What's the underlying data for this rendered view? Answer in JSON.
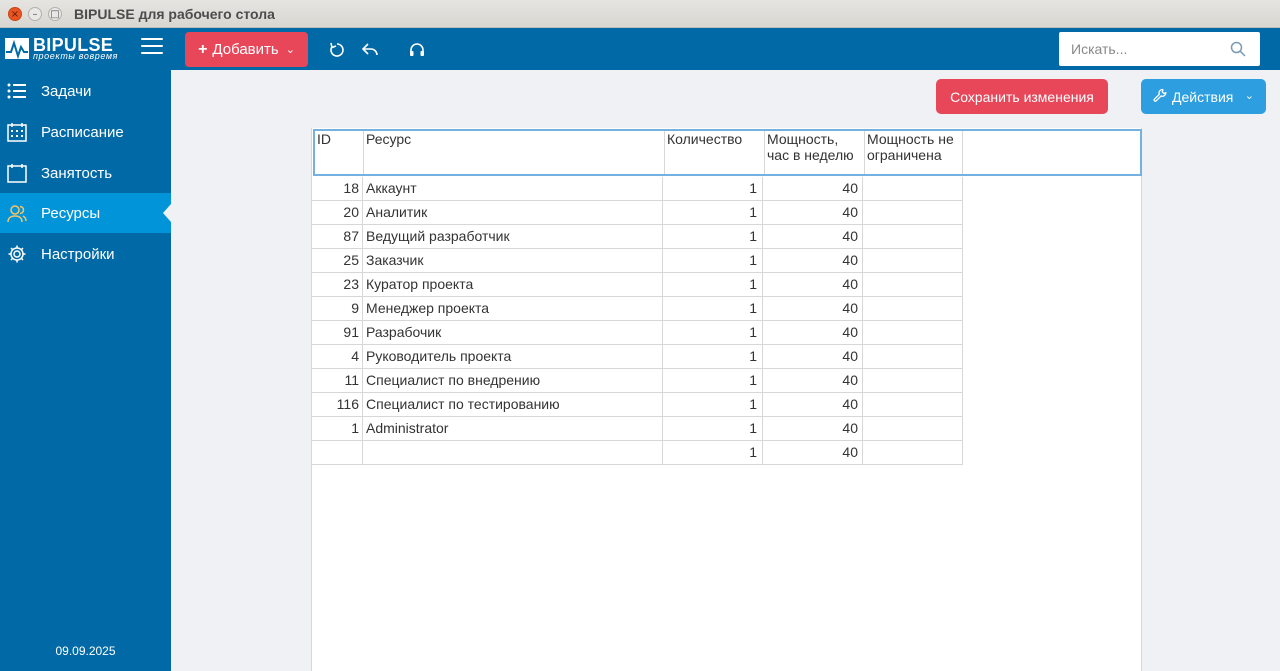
{
  "window": {
    "title": "BIPULSE для рабочего стола",
    "close_glyph": "×",
    "min_glyph": "–",
    "max_glyph": "□"
  },
  "logo": {
    "name": "BIPULSE",
    "tagline": "проекты вовремя"
  },
  "toolbar": {
    "add_label": "Добавить",
    "plus_glyph": "+",
    "chevron_glyph": "⌄",
    "accent": "#e8475a",
    "bar_color": "#016aa6"
  },
  "search": {
    "placeholder": "Искать..."
  },
  "sidebar": {
    "items": [
      {
        "label": "Задачи",
        "icon": "list-icon"
      },
      {
        "label": "Расписание",
        "icon": "calendar-icon"
      },
      {
        "label": "Занятость",
        "icon": "calendar-blank-icon"
      },
      {
        "label": "Ресурсы",
        "icon": "users-icon",
        "active": true
      },
      {
        "label": "Настройки",
        "icon": "gear-icon"
      }
    ],
    "date": "09.09.2025",
    "active_color": "#0294d8"
  },
  "actions": {
    "save_label": "Сохранить изменения",
    "actions_label": "Действия",
    "chevron_glyph": "⌄"
  },
  "table": {
    "columns": [
      "ID",
      "Ресурс",
      "Количество",
      "Мощность, час в неделю",
      "Мощность не ограничена"
    ],
    "rows": [
      {
        "id": "18",
        "resource": "Аккаунт",
        "qty": "1",
        "power": "40",
        "unlimited": ""
      },
      {
        "id": "20",
        "resource": "Аналитик",
        "qty": "1",
        "power": "40",
        "unlimited": ""
      },
      {
        "id": "87",
        "resource": "Ведущий разработчик",
        "qty": "1",
        "power": "40",
        "unlimited": ""
      },
      {
        "id": "25",
        "resource": "Заказчик",
        "qty": "1",
        "power": "40",
        "unlimited": ""
      },
      {
        "id": "23",
        "resource": "Куратор проекта",
        "qty": "1",
        "power": "40",
        "unlimited": ""
      },
      {
        "id": "9",
        "resource": "Менеджер проекта",
        "qty": "1",
        "power": "40",
        "unlimited": ""
      },
      {
        "id": "91",
        "resource": "Разрабочик",
        "qty": "1",
        "power": "40",
        "unlimited": ""
      },
      {
        "id": "4",
        "resource": "Руководитель проекта",
        "qty": "1",
        "power": "40",
        "unlimited": ""
      },
      {
        "id": "11",
        "resource": "Специалист по внедрению",
        "qty": "1",
        "power": "40",
        "unlimited": ""
      },
      {
        "id": "116",
        "resource": "Специалист по тестированию",
        "qty": "1",
        "power": "40",
        "unlimited": ""
      },
      {
        "id": "1",
        "resource": "Administrator",
        "qty": "1",
        "power": "40",
        "unlimited": ""
      },
      {
        "id": "",
        "resource": "",
        "qty": "1",
        "power": "40",
        "unlimited": ""
      }
    ]
  }
}
